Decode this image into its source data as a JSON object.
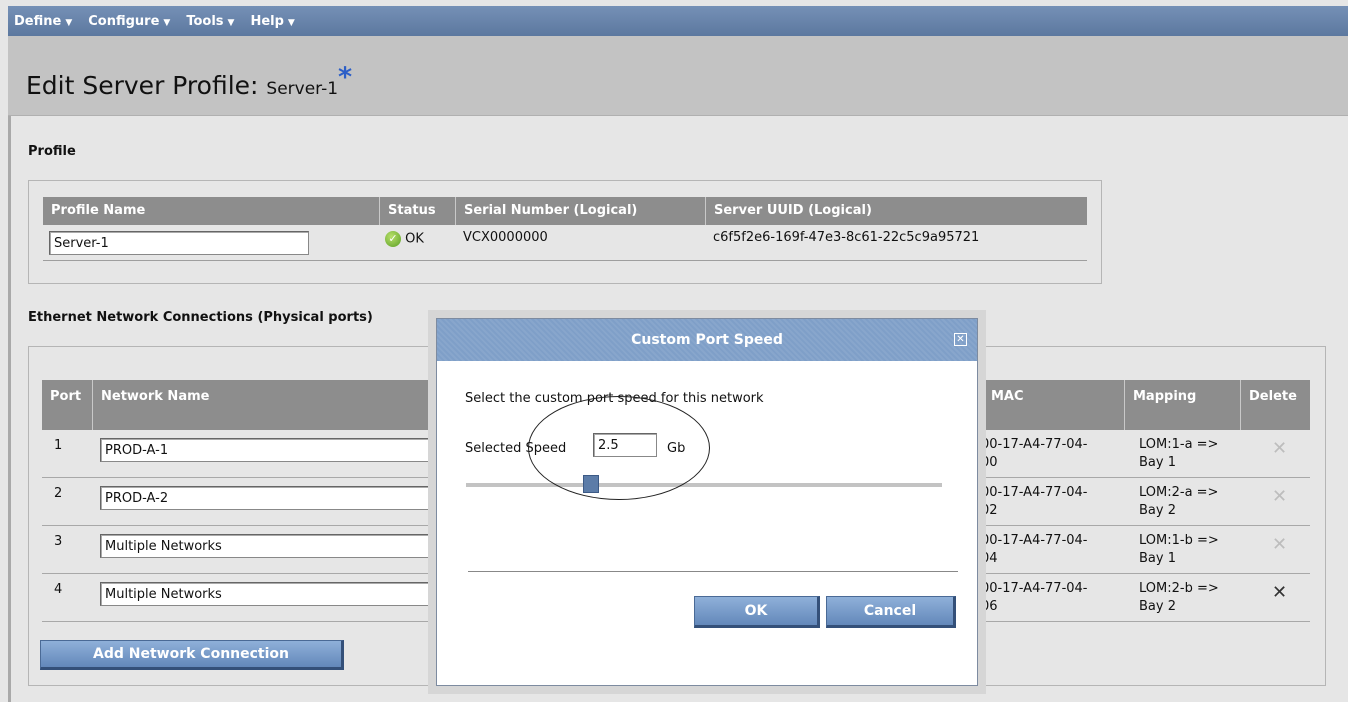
{
  "menu": [
    {
      "label": "Define"
    },
    {
      "label": "Configure"
    },
    {
      "label": "Tools"
    },
    {
      "label": "Help"
    }
  ],
  "page": {
    "title": "Edit Server Profile:",
    "profile_name": "Server-1",
    "unsaved_marker": "*"
  },
  "profile_section": {
    "label": "Profile",
    "headers": [
      "Profile Name",
      "Status",
      "Serial Number (Logical)",
      "Server UUID (Logical)"
    ],
    "name_value": "Server-1",
    "status": "OK",
    "serial": "VCX0000000",
    "uuid": "c6f5f2e6-169f-47e3-8c61-22c5c9a95721"
  },
  "ethernet_section": {
    "label": "Ethernet Network Connections (Physical ports)",
    "headers": {
      "port": "Port",
      "network": "Network Name",
      "mac": "MAC",
      "mapping": "Mapping",
      "delete": "Delete"
    },
    "rows": [
      {
        "port": "1",
        "network": "PROD-A-1",
        "mac1": "00-17-A4-77-04-",
        "mac2": "00",
        "map1": "LOM:1-a =>",
        "map2": "Bay 1"
      },
      {
        "port": "2",
        "network": "PROD-A-2",
        "mac1": "00-17-A4-77-04-",
        "mac2": "02",
        "map1": "LOM:2-a =>",
        "map2": "Bay 2"
      },
      {
        "port": "3",
        "network": "Multiple Networks",
        "mac1": "00-17-A4-77-04-",
        "mac2": "04",
        "map1": "LOM:1-b =>",
        "map2": "Bay 1"
      },
      {
        "port": "4",
        "network": "Multiple Networks",
        "mac1": "00-17-A4-77-04-",
        "mac2": "06",
        "map1": "LOM:2-b =>",
        "map2": "Bay 2"
      }
    ],
    "delete_glyph": "✕",
    "add_button": "Add Network Connection"
  },
  "dialog": {
    "title": "Custom Port Speed",
    "close_glyph": "✕",
    "prompt": "Select the custom port speed for this network",
    "speed_label": "Selected Speed",
    "speed_value": "2.5",
    "unit": "Gb",
    "ok": "OK",
    "cancel": "Cancel"
  },
  "colors": {
    "menubar": "#5c789f",
    "accent_button": "#6388ba",
    "table_header": "#8d8d8d",
    "status_ok": "#5a9e24",
    "unsaved_star": "#2d5fc7"
  },
  "icons": {
    "menu_caret": "chevron-down-icon",
    "status": "check-circle-icon",
    "delete": "delete-x-icon",
    "dialog_close": "close-icon"
  }
}
